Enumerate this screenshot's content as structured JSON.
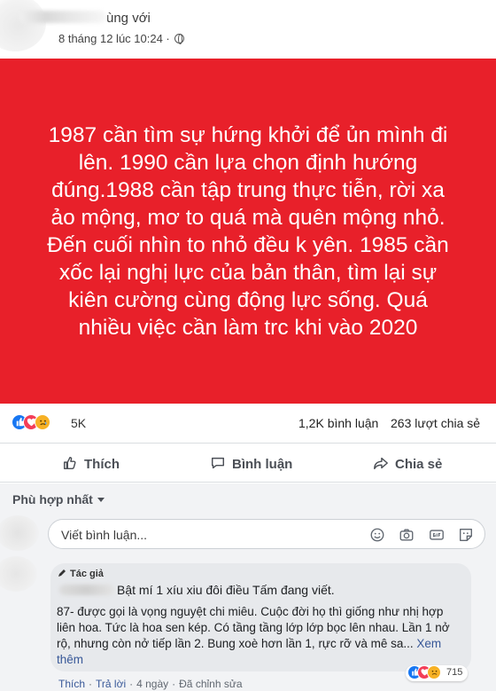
{
  "post": {
    "author_suffix": "ùng với",
    "timestamp": "8 tháng 12 lúc 10:24 ·",
    "text": "1987 cần tìm sự hứng khởi để ủn mình đi lên. 1990 cần lựa chọn định hướng đúng.1988 cần tập trung thực tiễn, rời xa ảo mộng, mơ to quá mà quên mộng nhỏ. Đến cuối nhìn to nhỏ đều k yên. 1985 cần xốc lại nghị lực của bản thân, tìm lại sự kiên cường cùng động lực sống. Quá nhiều việc cần làm trc khi vào 2020",
    "image_bg": "#e8202a"
  },
  "stats": {
    "reactions_count": "5K",
    "comments": "1,2K bình luận",
    "shares": "263 lượt chia sẻ",
    "reaction_icons": [
      "like-icon",
      "love-icon",
      "sad-icon"
    ]
  },
  "actions": {
    "like": "Thích",
    "comment": "Bình luận",
    "share": "Chia sẻ"
  },
  "comments": {
    "sort_label": "Phù hợp nhất",
    "input_placeholder": "Viết bình luận...",
    "input_icons": [
      "emoji-icon",
      "camera-icon",
      "gif-icon",
      "sticker-icon"
    ],
    "top_comment": {
      "author_badge": "Tác giả",
      "line1": "Bật mí 1 xíu xiu đôi điều Tấm đang viết.",
      "body": "87- được gọi là vọng nguyệt chi miêu. Cuộc đời họ thì giống như nhị hợp liên hoa. Tức là hoa sen kép. Có tầng tầng lớp lớp bọc lên nhau. Lần 1 nở rộ, nhưng còn nở tiếp lần 2. Bung xoè hơn lần 1, rực rỡ và mê sa...",
      "see_more": "Xem thêm",
      "reactions_count": "715",
      "like_action": "Thích",
      "reply_action": "Trả lời",
      "time": "4 ngày",
      "edited": "Đã chỉnh sửa"
    }
  },
  "colors": {
    "accent": "#1877f2",
    "love": "#f33e58",
    "sad": "#f7b125",
    "link": "#385898"
  }
}
